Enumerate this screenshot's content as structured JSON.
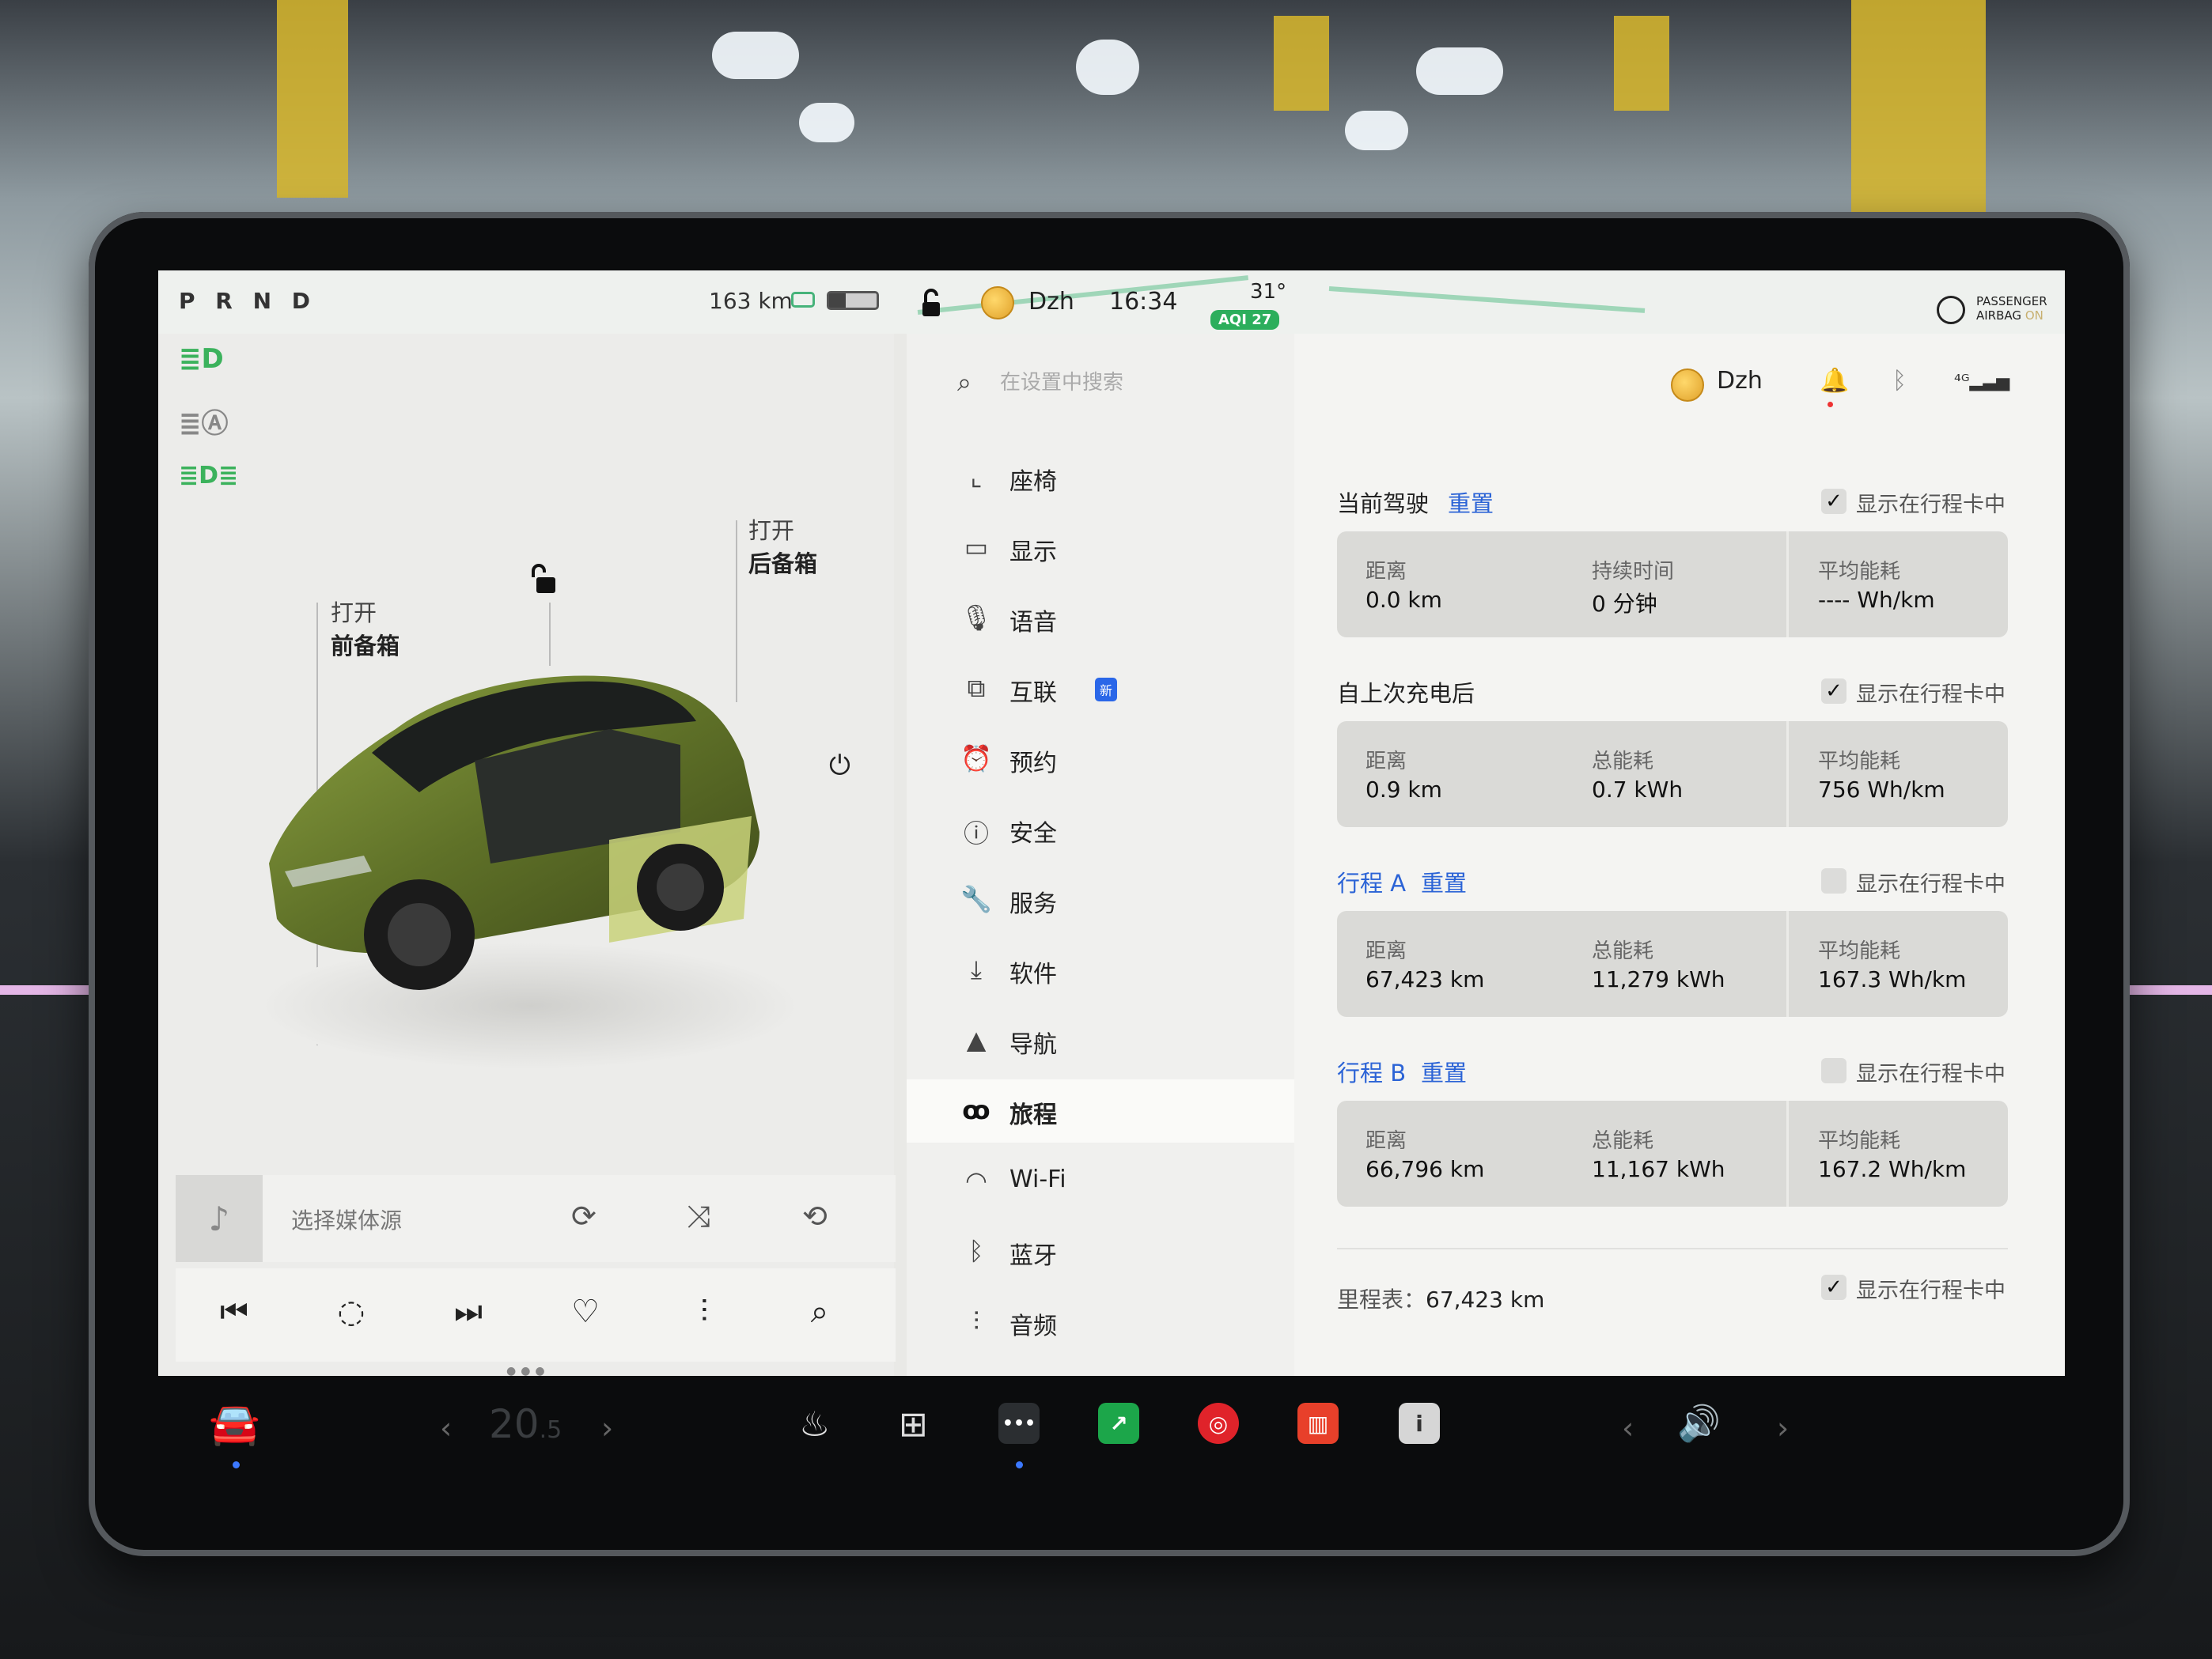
{
  "status_bar": {
    "gear": "P R N D",
    "range": "163 km",
    "user": "Dzh",
    "time": "16:34",
    "temperature": "31°",
    "aqi": "AQI 27",
    "airbag_line1": "PASSENGER",
    "airbag_line2": "AIRBAG",
    "airbag_state": "ON"
  },
  "left_panel": {
    "front_trunk_action": "打开",
    "front_trunk": "前备箱",
    "rear_trunk_action": "打开",
    "rear_trunk": "后备箱",
    "media_source": "选择媒体源"
  },
  "settings": {
    "search_placeholder": "在设置中搜索",
    "user": "Dzh",
    "nav": [
      {
        "label": "座椅",
        "icon": "seat-icon"
      },
      {
        "label": "显示",
        "icon": "display-icon"
      },
      {
        "label": "语音",
        "icon": "microphone-icon"
      },
      {
        "label": "互联",
        "icon": "connectivity-icon",
        "badge": "新"
      },
      {
        "label": "预约",
        "icon": "schedule-icon"
      },
      {
        "label": "安全",
        "icon": "safety-icon"
      },
      {
        "label": "服务",
        "icon": "wrench-icon"
      },
      {
        "label": "软件",
        "icon": "download-icon"
      },
      {
        "label": "导航",
        "icon": "navigation-icon"
      },
      {
        "label": "旅程",
        "icon": "trips-icon",
        "selected": true
      },
      {
        "label": "Wi-Fi",
        "icon": "wifi-icon"
      },
      {
        "label": "蓝牙",
        "icon": "bluetooth-icon"
      },
      {
        "label": "音频",
        "icon": "audio-icon"
      }
    ]
  },
  "trips": {
    "show_on_card": "显示在行程卡中",
    "reset": "重置",
    "current": {
      "title": "当前驾驶",
      "checked": true,
      "k1": "距离",
      "v1": "0.0 km",
      "k2": "持续时间",
      "v2": "0 分钟",
      "k3": "平均能耗",
      "v3": "---- Wh/km"
    },
    "since_charge": {
      "title": "自上次充电后",
      "checked": true,
      "k1": "距离",
      "v1": "0.9 km",
      "k2": "总能耗",
      "v2": "0.7 kWh",
      "k3": "平均能耗",
      "v3": "756 Wh/km"
    },
    "trip_a": {
      "title": "行程 A",
      "checked": false,
      "k1": "距离",
      "v1": "67,423 km",
      "k2": "总能耗",
      "v2": "11,279 kWh",
      "k3": "平均能耗",
      "v3": "167.3 Wh/km"
    },
    "trip_b": {
      "title": "行程 B",
      "checked": false,
      "k1": "距离",
      "v1": "66,796 km",
      "k2": "总能耗",
      "v2": "11,167 kWh",
      "k3": "平均能耗",
      "v3": "167.2 Wh/km"
    },
    "odometer_label": "里程表：",
    "odometer_value": "67,423 km",
    "odometer_checked": true
  },
  "taskbar": {
    "cabin_temp_main": "20",
    "cabin_temp_decimal": ".5"
  }
}
